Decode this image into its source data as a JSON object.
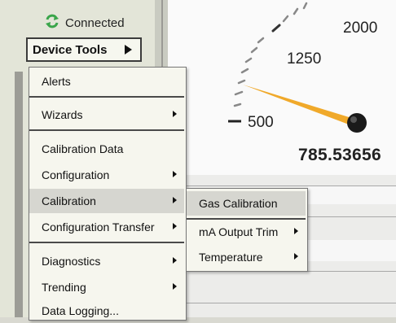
{
  "status": {
    "label": "Connected",
    "icon": "refresh-arrows-icon",
    "icon_color": "#3aa54a"
  },
  "device_tools": {
    "label": "Device Tools",
    "icon": "triangle-right-icon"
  },
  "gauge": {
    "max_label": "2000",
    "mid_label": "1250",
    "min_label": "500",
    "reading": "785.53656",
    "needle_color": "#f0a92a"
  },
  "menu": {
    "items": [
      {
        "label": "Alerts",
        "submenu": false
      },
      {
        "label": "Wizards",
        "submenu": true
      },
      {
        "label": "Calibration Data",
        "submenu": false
      },
      {
        "label": "Configuration",
        "submenu": true
      },
      {
        "label": "Calibration",
        "submenu": true,
        "highlighted": true
      },
      {
        "label": "Configuration Transfer",
        "submenu": true
      },
      {
        "label": "Diagnostics",
        "submenu": true
      },
      {
        "label": "Trending",
        "submenu": true
      },
      {
        "label": "Data Logging...",
        "submenu": false
      }
    ]
  },
  "submenu": {
    "items": [
      {
        "label": "Gas Calibration",
        "submenu": false,
        "highlighted": true
      },
      {
        "label": "mA Output Trim",
        "submenu": true
      },
      {
        "label": "Temperature",
        "submenu": true
      }
    ]
  }
}
